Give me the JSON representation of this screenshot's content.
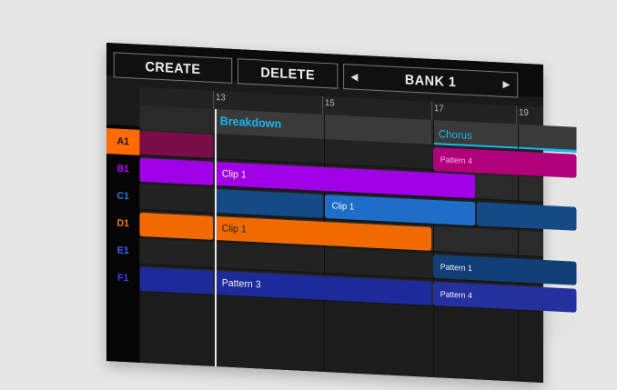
{
  "toolbar": {
    "create_label": "CREATE",
    "delete_label": "DELETE",
    "bank_label": "BANK 1",
    "bank_prev": "◀",
    "bank_next": "▶"
  },
  "ruler": {
    "marks": [
      "13",
      "15",
      "17",
      "19"
    ]
  },
  "sections": [
    {
      "label": "Breakdown"
    },
    {
      "label": "Chorus"
    }
  ],
  "tracks": [
    {
      "name": "A1",
      "color": "#ff6b00"
    },
    {
      "name": "B1",
      "color": "#b100ff"
    },
    {
      "name": "C1",
      "color": "#1b7ee0"
    },
    {
      "name": "D1",
      "color": "#ff7a00"
    },
    {
      "name": "E1",
      "color": "#2e6bff"
    },
    {
      "name": "F1",
      "color": "#3a3aff"
    }
  ],
  "clips": {
    "pattern4_a": "Pattern 4",
    "clip1_b": "Clip 1",
    "clip1_c": "Clip 1",
    "clip1_d": "Clip 1",
    "pattern1_e": "Pattern 1",
    "pattern3_f": "Pattern 3",
    "pattern4_f": "Pattern 4"
  }
}
